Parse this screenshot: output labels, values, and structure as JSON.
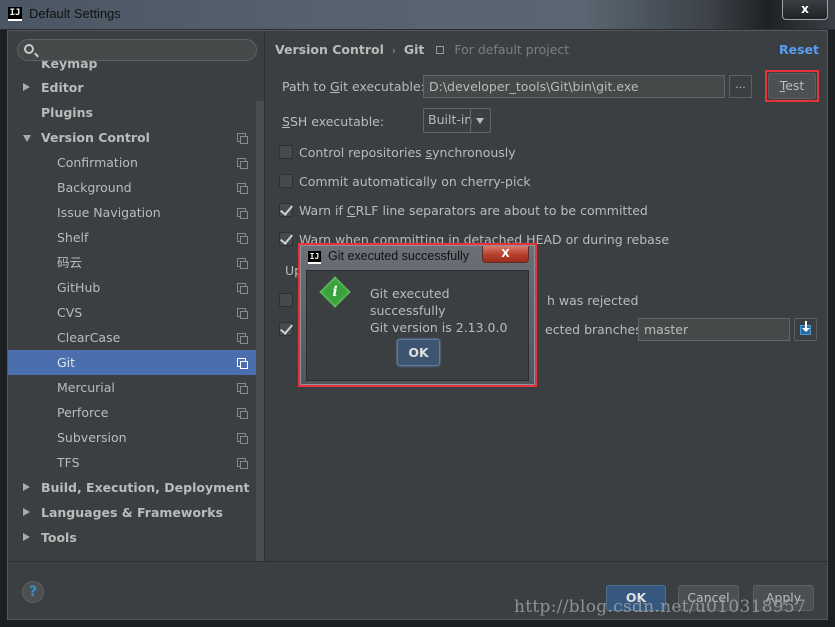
{
  "window": {
    "title": "Default Settings",
    "close_label": "x",
    "app_icon": "IJ"
  },
  "sidebar": {
    "search_placeholder": "",
    "items": [
      {
        "label": "Keymap",
        "level": 0,
        "arrow": "none",
        "partial": true
      },
      {
        "label": "Editor",
        "level": 0,
        "arrow": "right"
      },
      {
        "label": "Plugins",
        "level": 0,
        "arrow": "none"
      },
      {
        "label": "Version Control",
        "level": 0,
        "arrow": "down",
        "project_icon": true
      },
      {
        "label": "Confirmation",
        "level": 1,
        "project_icon": true
      },
      {
        "label": "Background",
        "level": 1,
        "project_icon": true
      },
      {
        "label": "Issue Navigation",
        "level": 1,
        "project_icon": true
      },
      {
        "label": "Shelf",
        "level": 1,
        "project_icon": true
      },
      {
        "label": "码云",
        "level": 1,
        "project_icon": true
      },
      {
        "label": "GitHub",
        "level": 1,
        "project_icon": true
      },
      {
        "label": "CVS",
        "level": 1,
        "project_icon": true
      },
      {
        "label": "ClearCase",
        "level": 1,
        "project_icon": true
      },
      {
        "label": "Git",
        "level": 1,
        "project_icon": true,
        "selected": true
      },
      {
        "label": "Mercurial",
        "level": 1,
        "project_icon": true
      },
      {
        "label": "Perforce",
        "level": 1,
        "project_icon": true
      },
      {
        "label": "Subversion",
        "level": 1,
        "project_icon": true
      },
      {
        "label": "TFS",
        "level": 1,
        "project_icon": true
      },
      {
        "label": "Build, Execution, Deployment",
        "level": 0,
        "arrow": "right"
      },
      {
        "label": "Languages & Frameworks",
        "level": 0,
        "arrow": "right"
      },
      {
        "label": "Tools",
        "level": 0,
        "arrow": "right"
      }
    ]
  },
  "content": {
    "breadcrumb": {
      "parent": "Version Control",
      "separator": "›",
      "current": "Git",
      "scope_note": "For default project"
    },
    "reset_label": "Reset",
    "git_path": {
      "label_pre": "Path to ",
      "label_mnemonic": "G",
      "label_post": "it executable:",
      "value": "D:\\developer_tools\\Git\\bin\\git.exe",
      "browse_label": "...",
      "test_mnemonic": "T",
      "test_rest": "est"
    },
    "ssh": {
      "label_mnemonic": "S",
      "label_post": "SH executable:",
      "selected": "Built-in"
    },
    "checkboxes": [
      {
        "pre": "Control repositories ",
        "mn": "s",
        "post": "ynchronously",
        "checked": false
      },
      {
        "pre": "Commit automatically on cherry-pick",
        "mn": "",
        "post": "",
        "checked": false
      },
      {
        "pre": "Warn if ",
        "mn": "C",
        "post": "RLF line separators are about to be committed",
        "checked": true
      },
      {
        "pre": "Warn when committing in detached HEAD or during rebase",
        "mn": "",
        "post": "",
        "checked": true
      }
    ],
    "update_label_partial": "Up",
    "push_rejected_partial": "h was rejected",
    "protected_branches_partial": "ected branches:",
    "protected_branches_value": "master"
  },
  "footer": {
    "help_label": "?",
    "ok_label": "OK",
    "cancel_label": "Cancel",
    "apply_label": "Apply"
  },
  "watermark": "http://blog.csdn.net/u010318957",
  "modal": {
    "title": "Git executed successfully",
    "close_label": "X",
    "icon": "info-icon",
    "icon_glyph": "i",
    "message_line1": "Git executed successfully",
    "message_line2": "Git version is 2.13.0.0",
    "ok_label": "OK"
  },
  "colors": {
    "accent_link": "#589df6",
    "selection": "#4b6eaf",
    "highlight_box": "#e8333a",
    "info_icon": "#3aa23a"
  }
}
